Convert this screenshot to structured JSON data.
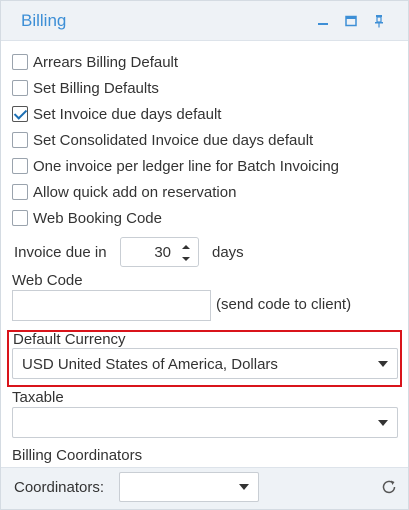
{
  "panel": {
    "title": "Billing",
    "accent_color": "#3d8fd6",
    "header_icons": [
      "minimize-icon",
      "maximize-icon",
      "pin-icon"
    ]
  },
  "checkboxes": [
    {
      "label": "Arrears Billing Default",
      "checked": false
    },
    {
      "label": "Set Billing Defaults",
      "checked": false
    },
    {
      "label": "Set Invoice due days default",
      "checked": true
    },
    {
      "label": "Set Consolidated Invoice due days default",
      "checked": false
    },
    {
      "label": "One invoice per ledger line for Batch Invoicing",
      "checked": false
    },
    {
      "label": "Allow quick add on reservation",
      "checked": false
    },
    {
      "label": "Web Booking Code",
      "checked": false
    }
  ],
  "invoice_due": {
    "label": "Invoice due in",
    "value": "30",
    "unit": "days"
  },
  "web_code": {
    "label": "Web Code",
    "value": "",
    "hint": "(send code to client)"
  },
  "default_currency": {
    "label": "Default Currency",
    "selected": "USD United States of America, Dollars",
    "highlight_color": "#d9141b"
  },
  "taxable": {
    "label": "Taxable",
    "selected": ""
  },
  "billing_coordinators": {
    "label": "Billing Coordinators",
    "field_label": "Coordinators:",
    "selected": ""
  }
}
